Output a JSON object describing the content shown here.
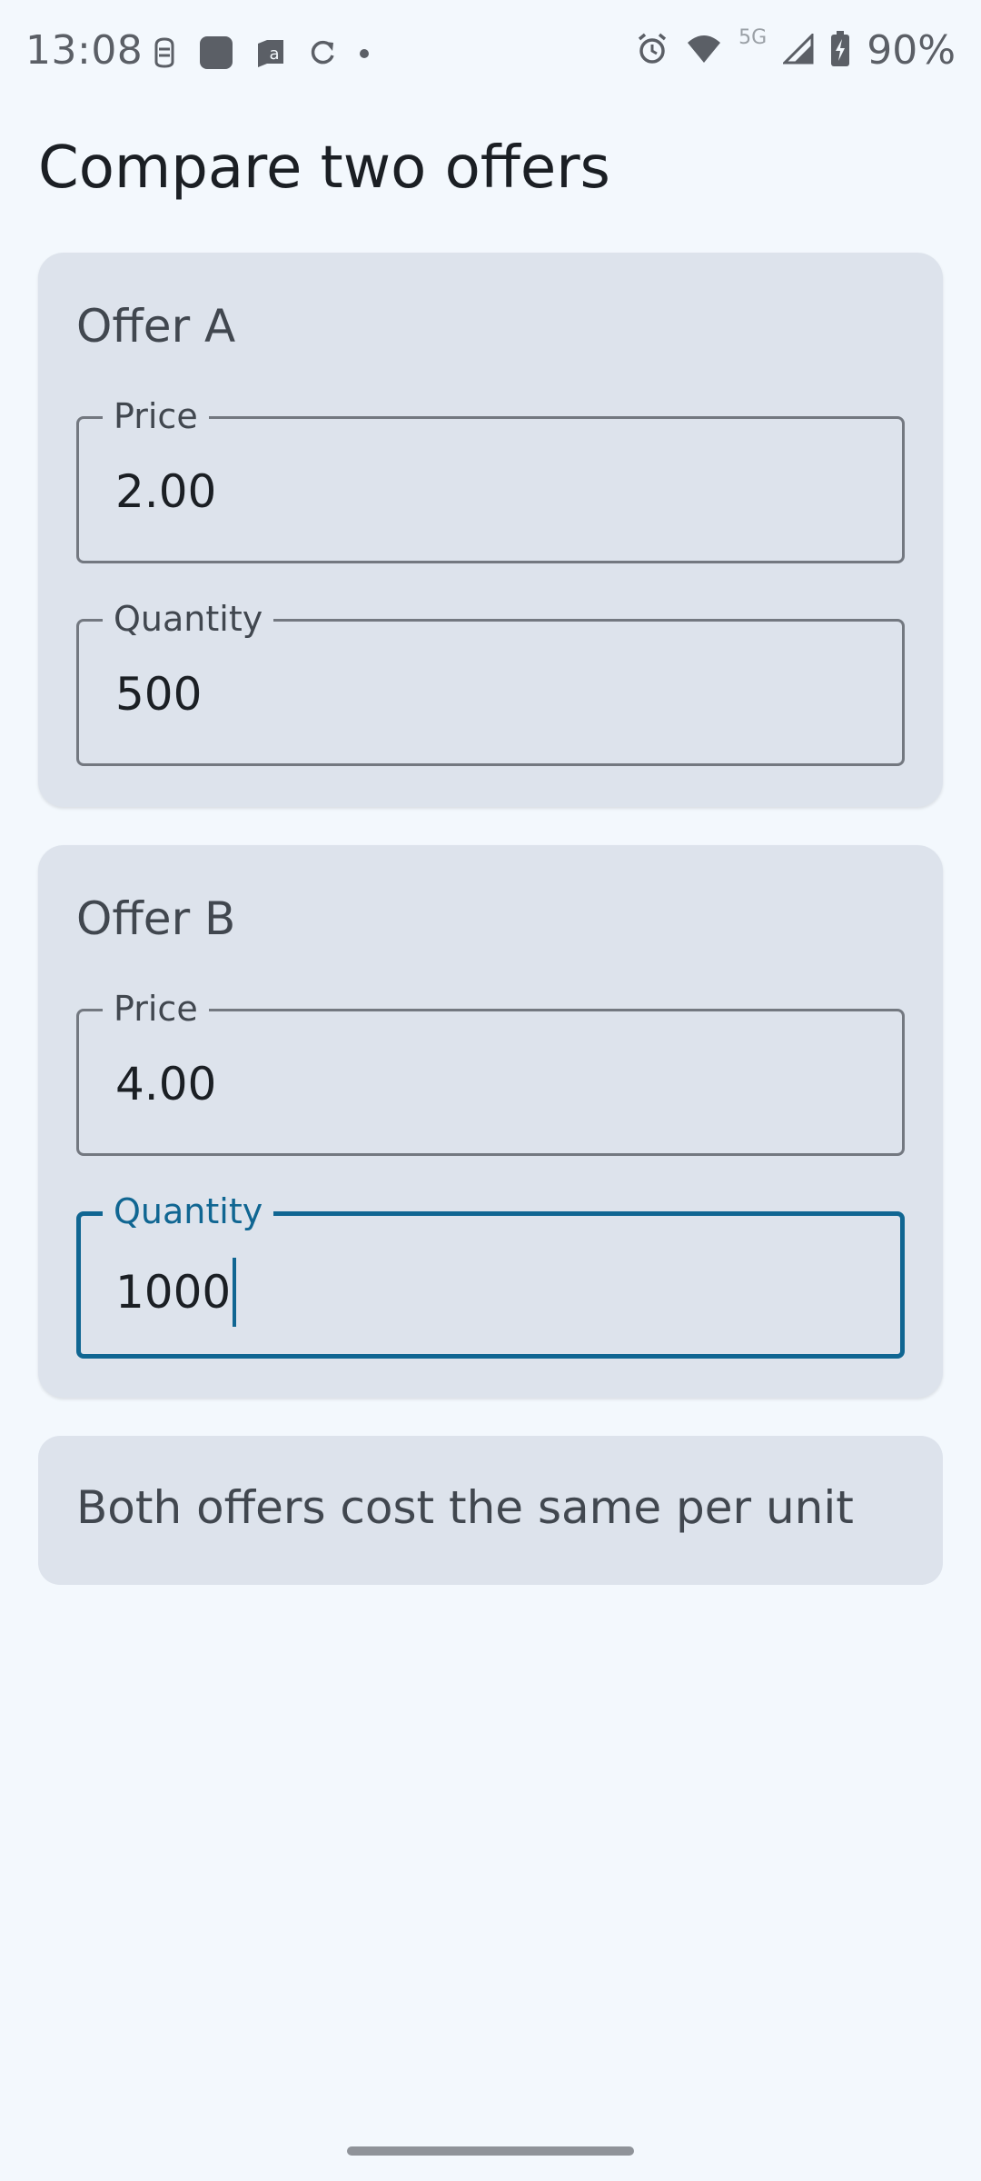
{
  "status_bar": {
    "time": "13:08",
    "network_label": "5G",
    "battery_percent": "90%",
    "left_icons": [
      "notification-icon",
      "app-square-icon",
      "amazon-icon",
      "sync-icon",
      "dot-icon"
    ],
    "right_icons": [
      "alarm-icon",
      "wifi-icon",
      "signal-icon",
      "battery-charging-icon"
    ]
  },
  "page": {
    "title": "Compare two offers"
  },
  "offers": [
    {
      "title": "Offer A",
      "price_label": "Price",
      "price_value": "2.00",
      "quantity_label": "Quantity",
      "quantity_value": "500"
    },
    {
      "title": "Offer B",
      "price_label": "Price",
      "price_value": "4.00",
      "quantity_label": "Quantity",
      "quantity_value": "1000"
    }
  ],
  "result": {
    "text": "Both offers cost the same per unit"
  },
  "colors": {
    "background": "#f3f8fd",
    "card": "#dde3ec",
    "accent": "#106692",
    "outline": "#737880"
  }
}
